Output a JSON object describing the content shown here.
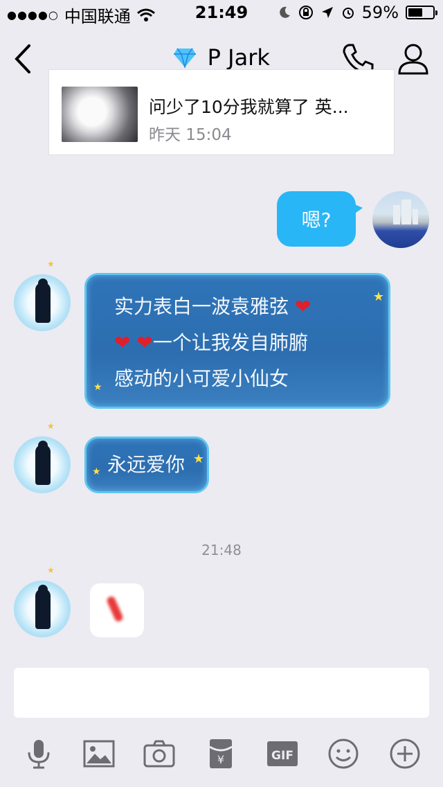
{
  "status_bar": {
    "carrier": "中国联通",
    "time": "21:49",
    "battery_percent": "59%",
    "battery_level": 0.59,
    "signal_bars": "●●●●○"
  },
  "nav": {
    "title": "P Jark",
    "title_gem_icon": "diamond-icon",
    "icons": [
      "chevron-left-icon",
      "phone-icon",
      "user-icon"
    ]
  },
  "shared_card": {
    "title": "问少了10分我就算了 英...",
    "time": "昨天 15:04"
  },
  "messages": {
    "outgoing_1": "嗯?",
    "incoming_1_line1": "实力表白一波袁雅弦",
    "incoming_1_line2": "一个让我发自肺腑",
    "incoming_1_line3": "感动的小可爱小仙女",
    "incoming_2": "永远爱你",
    "timestamp": "21:48"
  },
  "colors": {
    "outgoing_bubble": "#29b6f6",
    "incoming_bubble": "#2f74b8",
    "background": "#ebebf1"
  },
  "toolbar": {
    "icons": [
      "microphone-icon",
      "image-icon",
      "camera-icon",
      "red-packet-icon",
      "gif-icon",
      "emoji-icon",
      "plus-icon"
    ],
    "gif_label": "GIF"
  }
}
